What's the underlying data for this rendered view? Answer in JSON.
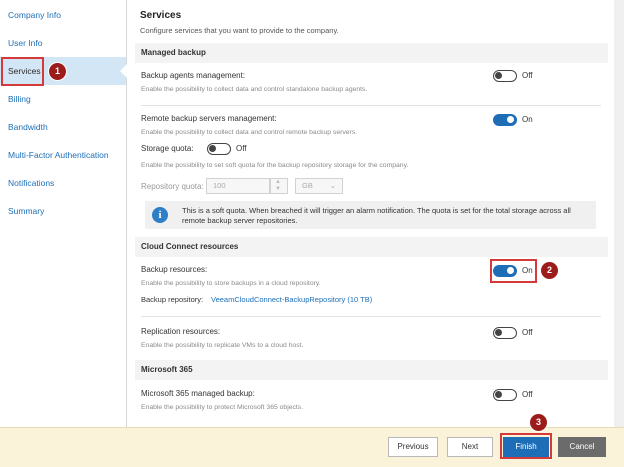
{
  "sidebar": {
    "items": [
      {
        "label": "Company Info"
      },
      {
        "label": "User Info"
      },
      {
        "label": "Services"
      },
      {
        "label": "Billing"
      },
      {
        "label": "Bandwidth"
      },
      {
        "label": "Multi-Factor Authentication"
      },
      {
        "label": "Notifications"
      },
      {
        "label": "Summary"
      }
    ]
  },
  "page": {
    "title": "Services",
    "subtitle": "Configure services that you want to provide to the company."
  },
  "managed_backup": {
    "header": "Managed backup",
    "agents": {
      "label": "Backup agents management:",
      "desc": "Enable the possibility to collect data and control standalone backup agents.",
      "state": "Off"
    },
    "servers": {
      "label": "Remote backup servers management:",
      "desc": "Enable the possibility to collect data and control remote backup servers.",
      "state": "On"
    },
    "storage_quota": {
      "label": "Storage quota:",
      "state": "Off",
      "desc": "Enable the possibility to set soft quota for the backup repository storage for the company."
    },
    "repo_quota": {
      "label": "Repository quota:",
      "value": "100",
      "unit": "GB"
    },
    "info": "This is a soft quota. When breached it will trigger an alarm notification. The quota is set for the total storage across all remote backup server repositories."
  },
  "cloud_connect": {
    "header": "Cloud Connect resources",
    "backup": {
      "label": "Backup resources:",
      "desc": "Enable the possibility to store backups in a cloud repository.",
      "state": "On",
      "repo_label": "Backup repository:",
      "repo_link": "VeeamCloudConnect-BackupRepository (10 TB)"
    },
    "replication": {
      "label": "Replication resources:",
      "desc": "Enable the possibility to replicate VMs to a cloud host.",
      "state": "Off"
    }
  },
  "m365": {
    "header": "Microsoft 365",
    "managed": {
      "label": "Microsoft 365 managed backup:",
      "desc": "Enable the possibility to protect Microsoft 365 objects.",
      "state": "Off"
    }
  },
  "footer": {
    "previous": "Previous",
    "next": "Next",
    "finish": "Finish",
    "cancel": "Cancel"
  },
  "callouts": [
    "1",
    "2",
    "3"
  ],
  "colors": {
    "accent": "#1e6eb7",
    "callout": "#9c1b1b",
    "highlight": "#d43a3a",
    "footer_bg": "#fbf3d9"
  }
}
